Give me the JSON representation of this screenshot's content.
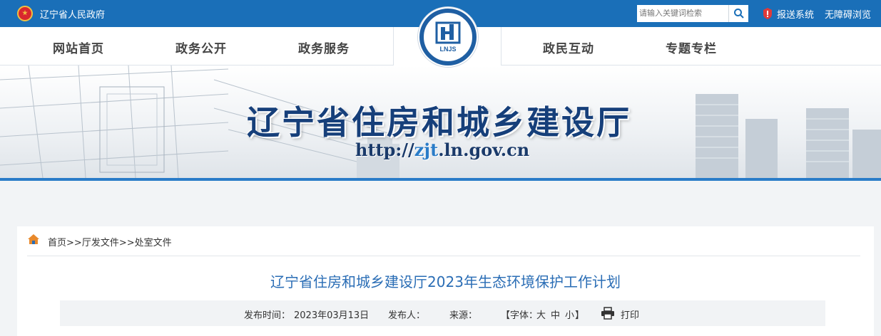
{
  "topbar": {
    "gov_name": "辽宁省人民政府",
    "search_placeholder": "请输入关键词检索",
    "search_icon": "search-icon",
    "report_label": "报送系统",
    "accessibility_label": "无障碍浏览",
    "background_color": "#1a6fb8"
  },
  "nav": {
    "items": [
      {
        "label": "网站首页"
      },
      {
        "label": "政务公开"
      },
      {
        "label": "政务服务"
      },
      {
        "label": "政民互动"
      },
      {
        "label": "专题专栏"
      }
    ],
    "logo_text": "LNJS"
  },
  "banner": {
    "title": "辽宁省住房和城乡建设厅",
    "url_prefix": "http://",
    "url_highlight": "zjt",
    "url_suffix": ".ln.gov.cn"
  },
  "breadcrumb": {
    "home": "首页",
    "sep1": ">>",
    "level1": "厅发文件",
    "sep2": ">>",
    "level2": "处室文件"
  },
  "article": {
    "title": "辽宁省住房和城乡建设厅2023年生态环境保护工作计划",
    "publish_time_label": "发布时间：",
    "publish_time": "2023年03月13日",
    "publisher_label": "发布人：",
    "source_label": "来源：",
    "font_open": "【字体：",
    "font_large": "大",
    "font_medium": "中",
    "font_small": "小",
    "font_close": "】",
    "print_label": "打印"
  },
  "colors": {
    "accent": "#1a6fb8",
    "title_blue": "#2a6db5",
    "banner_title": "#163f7a"
  }
}
